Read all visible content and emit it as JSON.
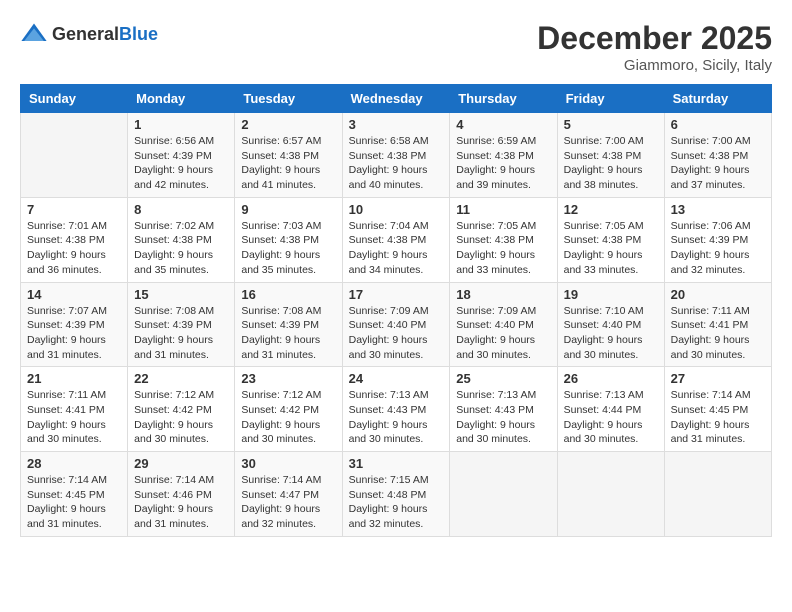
{
  "logo": {
    "text_general": "General",
    "text_blue": "Blue"
  },
  "header": {
    "month": "December 2025",
    "location": "Giammoro, Sicily, Italy"
  },
  "weekdays": [
    "Sunday",
    "Monday",
    "Tuesday",
    "Wednesday",
    "Thursday",
    "Friday",
    "Saturday"
  ],
  "weeks": [
    [
      {
        "day": "",
        "info": ""
      },
      {
        "day": "1",
        "info": "Sunrise: 6:56 AM\nSunset: 4:39 PM\nDaylight: 9 hours\nand 42 minutes."
      },
      {
        "day": "2",
        "info": "Sunrise: 6:57 AM\nSunset: 4:38 PM\nDaylight: 9 hours\nand 41 minutes."
      },
      {
        "day": "3",
        "info": "Sunrise: 6:58 AM\nSunset: 4:38 PM\nDaylight: 9 hours\nand 40 minutes."
      },
      {
        "day": "4",
        "info": "Sunrise: 6:59 AM\nSunset: 4:38 PM\nDaylight: 9 hours\nand 39 minutes."
      },
      {
        "day": "5",
        "info": "Sunrise: 7:00 AM\nSunset: 4:38 PM\nDaylight: 9 hours\nand 38 minutes."
      },
      {
        "day": "6",
        "info": "Sunrise: 7:00 AM\nSunset: 4:38 PM\nDaylight: 9 hours\nand 37 minutes."
      }
    ],
    [
      {
        "day": "7",
        "info": "Sunrise: 7:01 AM\nSunset: 4:38 PM\nDaylight: 9 hours\nand 36 minutes."
      },
      {
        "day": "8",
        "info": "Sunrise: 7:02 AM\nSunset: 4:38 PM\nDaylight: 9 hours\nand 35 minutes."
      },
      {
        "day": "9",
        "info": "Sunrise: 7:03 AM\nSunset: 4:38 PM\nDaylight: 9 hours\nand 35 minutes."
      },
      {
        "day": "10",
        "info": "Sunrise: 7:04 AM\nSunset: 4:38 PM\nDaylight: 9 hours\nand 34 minutes."
      },
      {
        "day": "11",
        "info": "Sunrise: 7:05 AM\nSunset: 4:38 PM\nDaylight: 9 hours\nand 33 minutes."
      },
      {
        "day": "12",
        "info": "Sunrise: 7:05 AM\nSunset: 4:38 PM\nDaylight: 9 hours\nand 33 minutes."
      },
      {
        "day": "13",
        "info": "Sunrise: 7:06 AM\nSunset: 4:39 PM\nDaylight: 9 hours\nand 32 minutes."
      }
    ],
    [
      {
        "day": "14",
        "info": "Sunrise: 7:07 AM\nSunset: 4:39 PM\nDaylight: 9 hours\nand 31 minutes."
      },
      {
        "day": "15",
        "info": "Sunrise: 7:08 AM\nSunset: 4:39 PM\nDaylight: 9 hours\nand 31 minutes."
      },
      {
        "day": "16",
        "info": "Sunrise: 7:08 AM\nSunset: 4:39 PM\nDaylight: 9 hours\nand 31 minutes."
      },
      {
        "day": "17",
        "info": "Sunrise: 7:09 AM\nSunset: 4:40 PM\nDaylight: 9 hours\nand 30 minutes."
      },
      {
        "day": "18",
        "info": "Sunrise: 7:09 AM\nSunset: 4:40 PM\nDaylight: 9 hours\nand 30 minutes."
      },
      {
        "day": "19",
        "info": "Sunrise: 7:10 AM\nSunset: 4:40 PM\nDaylight: 9 hours\nand 30 minutes."
      },
      {
        "day": "20",
        "info": "Sunrise: 7:11 AM\nSunset: 4:41 PM\nDaylight: 9 hours\nand 30 minutes."
      }
    ],
    [
      {
        "day": "21",
        "info": "Sunrise: 7:11 AM\nSunset: 4:41 PM\nDaylight: 9 hours\nand 30 minutes."
      },
      {
        "day": "22",
        "info": "Sunrise: 7:12 AM\nSunset: 4:42 PM\nDaylight: 9 hours\nand 30 minutes."
      },
      {
        "day": "23",
        "info": "Sunrise: 7:12 AM\nSunset: 4:42 PM\nDaylight: 9 hours\nand 30 minutes."
      },
      {
        "day": "24",
        "info": "Sunrise: 7:13 AM\nSunset: 4:43 PM\nDaylight: 9 hours\nand 30 minutes."
      },
      {
        "day": "25",
        "info": "Sunrise: 7:13 AM\nSunset: 4:43 PM\nDaylight: 9 hours\nand 30 minutes."
      },
      {
        "day": "26",
        "info": "Sunrise: 7:13 AM\nSunset: 4:44 PM\nDaylight: 9 hours\nand 30 minutes."
      },
      {
        "day": "27",
        "info": "Sunrise: 7:14 AM\nSunset: 4:45 PM\nDaylight: 9 hours\nand 31 minutes."
      }
    ],
    [
      {
        "day": "28",
        "info": "Sunrise: 7:14 AM\nSunset: 4:45 PM\nDaylight: 9 hours\nand 31 minutes."
      },
      {
        "day": "29",
        "info": "Sunrise: 7:14 AM\nSunset: 4:46 PM\nDaylight: 9 hours\nand 31 minutes."
      },
      {
        "day": "30",
        "info": "Sunrise: 7:14 AM\nSunset: 4:47 PM\nDaylight: 9 hours\nand 32 minutes."
      },
      {
        "day": "31",
        "info": "Sunrise: 7:15 AM\nSunset: 4:48 PM\nDaylight: 9 hours\nand 32 minutes."
      },
      {
        "day": "",
        "info": ""
      },
      {
        "day": "",
        "info": ""
      },
      {
        "day": "",
        "info": ""
      }
    ]
  ]
}
